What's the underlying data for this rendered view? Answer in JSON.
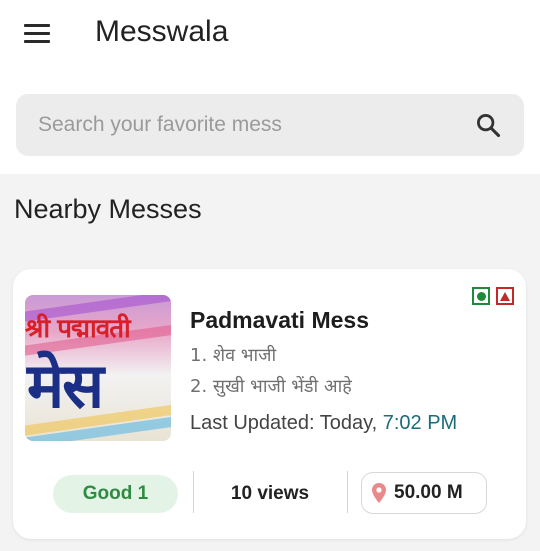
{
  "app_bar": {
    "title": "Messwala",
    "menu_icon": "hamburger-menu-icon"
  },
  "search": {
    "placeholder": "Search your favorite mess",
    "value": "",
    "icon": "search-icon"
  },
  "section": {
    "title": "Nearby Messes"
  },
  "messes": [
    {
      "name": "Padmavati Mess",
      "thumbnail_text_top": "श्री पद्मावती",
      "thumbnail_text_big": "मेस",
      "menu_items": [
        "1. शेव भाजी",
        "2. सुखी भाजी भेंडी आहे"
      ],
      "updated_label": "Last Updated: Today,",
      "updated_time": "7:02 PM",
      "rating_label": "Good 1",
      "views_label": "10 views",
      "distance_label": "50.00 M",
      "badges": [
        "veg-badge-icon",
        "non-veg-badge-icon"
      ]
    }
  ],
  "colors": {
    "rating_bg": "#e3f3e6",
    "rating_text": "#2f8a44",
    "time_accent": "#1c6b7a",
    "veg_green": "#1e8a3a",
    "nonveg_red": "#c62828",
    "pin_color": "#e88a8a"
  }
}
